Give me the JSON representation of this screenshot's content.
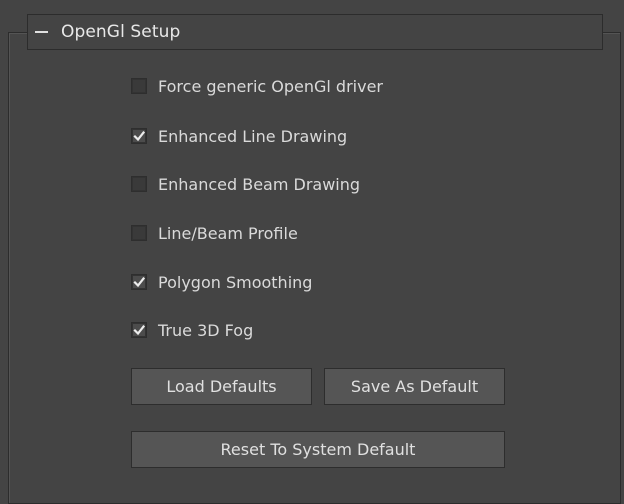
{
  "rollout": {
    "title": "OpenGl Setup",
    "collapse_icon": "minus-icon"
  },
  "options": [
    {
      "label": "Force generic OpenGl driver",
      "checked": false
    },
    {
      "label": "Enhanced Line Drawing",
      "checked": true
    },
    {
      "label": "Enhanced Beam Drawing",
      "checked": false
    },
    {
      "label": "Line/Beam Profile",
      "checked": false
    },
    {
      "label": "Polygon Smoothing",
      "checked": true
    },
    {
      "label": "True 3D Fog",
      "checked": true
    }
  ],
  "buttons": {
    "load_defaults": "Load Defaults",
    "save_as_default": "Save As Default",
    "reset_to_system_default": "Reset To System Default"
  },
  "colors": {
    "panel_bg": "#444444",
    "border": "#2c2c2c",
    "text": "#dadada",
    "button_bg": "#555555"
  }
}
